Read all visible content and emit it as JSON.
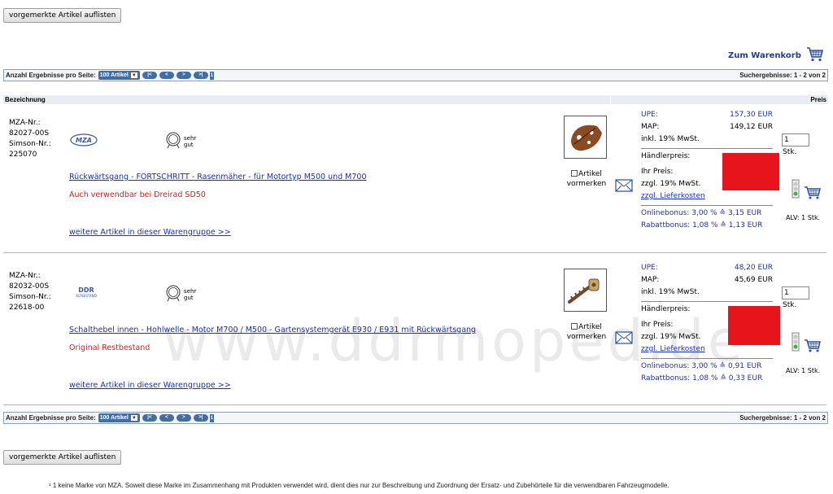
{
  "top_button": "vorgemerkte Artikel auflisten",
  "bottom_button": "vorgemerkte Artikel auflisten",
  "cart_link": {
    "label": "Zum Warenkorb",
    "icon": "shopping-cart-icon"
  },
  "pager": {
    "label": "Anzahl Ergebnisse pro Seite:",
    "per_page": "100 Artikel",
    "nav": [
      "|<",
      "<",
      ">",
      ">|"
    ],
    "page": "1",
    "results": "Suchergebnisse: 1 - 2 von 2"
  },
  "table_header": {
    "name": "Bezeichnung",
    "price": "Preis"
  },
  "articles": [
    {
      "mza_label": "MZA-Nr.:",
      "mza_nr": "82027-00S",
      "simson_label": "Simson-Nr.:",
      "simson_nr": "225070",
      "brand": "MZA",
      "rating": "sehr gut",
      "title": "Rückwärtsgang - FORTSCHRITT - Rasenmäher - für Motortyp M500 und M700",
      "note": "Auch verwendbar bei Dreirad SD50",
      "more": "weitere Artikel in dieser Warengruppe >>",
      "memo": "Artikel vormerken",
      "upe_label": "UPE:",
      "upe": "157,30 EUR",
      "map_label": "MAP:",
      "map": "149,12 EUR",
      "vat": "inkl. 19% MwSt.",
      "dealer_label": "Händlerpreis:",
      "your_price": "Ihr Preis:",
      "vat_excl": "zzgl. 19% MwSt.",
      "shipping": "zzgl. Lieferkosten",
      "online_bonus": "Onlinebonus:  3,00 % ≙ 3,15 EUR",
      "discount_bonus": "Rabattbonus: 1,08 % ≙ 1,13 EUR",
      "qty": "1",
      "stk": "Stk.",
      "alv": "ALV: 1 Stk."
    },
    {
      "mza_label": "MZA-Nr.:",
      "mza_nr": "82032-00S",
      "simson_label": "Simson-Nr.:",
      "simson_nr": "22618-00",
      "brand": "DDR ALTBESTAND",
      "rating": "sehr gut",
      "title": "Schalthebel innen - Hohlwelle - Motor M700 / M500 - Gartensystemgerät E930 / E931 mit Rückwärtsgang",
      "note": "Original Restbestand",
      "more": "weitere Artikel in dieser Warengruppe >>",
      "memo": "Artikel vormerken",
      "upe_label": "UPE:",
      "upe": "48,20 EUR",
      "map_label": "MAP:",
      "map": "45,69 EUR",
      "vat": "inkl. 19% MwSt.",
      "dealer_label": "Händlerpreis:",
      "your_price": "Ihr Preis:",
      "vat_excl": "zzgl. 19% MwSt.",
      "shipping": "zzgl. Lieferkosten",
      "online_bonus": "Onlinebonus:  3,00 % ≙ 0,91 EUR",
      "discount_bonus": "Rabattbonus: 1,08 % ≙ 0,33 EUR",
      "qty": "1",
      "stk": "Stk.",
      "alv": "ALV: 1 Stk."
    }
  ],
  "watermark": "www.ddrmoped.de",
  "footnote": "¹ 1 keine Marke von MZA. Soweit diese Marke im Zusammenhang mit Produkten verwendet wird, dient dies nur zur Beschreibung und Zuordnung der Ersatz- und Zubehörteile für die verwendbaren Fahrzeugmodelle.",
  "colors": {
    "link": "#1a2fb5",
    "price": "#23309a",
    "red": "#e8141b",
    "pager": "#3f6fa6"
  }
}
